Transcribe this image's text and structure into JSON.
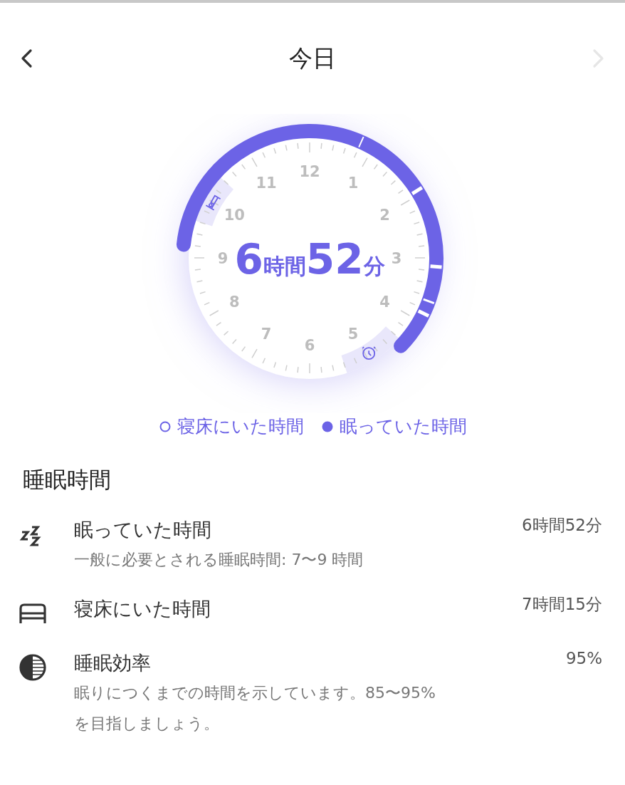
{
  "header": {
    "title": "今日",
    "back_disabled": false,
    "forward_disabled": true
  },
  "dial": {
    "numbers": [
      "12",
      "1",
      "2",
      "3",
      "4",
      "5",
      "6",
      "7",
      "8",
      "9",
      "10",
      "11"
    ],
    "duration": [
      {
        "kind": "number",
        "text": "6"
      },
      {
        "kind": "unit",
        "text": "時間"
      },
      {
        "kind": "number",
        "text": "52"
      },
      {
        "kind": "unit",
        "text": "分"
      }
    ]
  },
  "legend": [
    {
      "kind": "outline",
      "label": "寝床にいた時間"
    },
    {
      "kind": "filled",
      "label": "眠っていた時間"
    }
  ],
  "section": {
    "title": "睡眠時間",
    "rows": [
      {
        "kind": "sleep",
        "title": "眠っていた時間",
        "subtitle": [
          "一般に必要とされる睡眠時間: 7〜9 時間"
        ],
        "value": "6時間52分"
      },
      {
        "kind": "bed",
        "title": "寝床にいた時間",
        "value": "7時間15分"
      },
      {
        "kind": "efficiency",
        "title": "睡眠効率",
        "subtitle": [
          "眠りにつくまでの時間を示しています。85〜95%",
          "を目指しましょう。"
        ],
        "value": "95%"
      }
    ]
  }
}
